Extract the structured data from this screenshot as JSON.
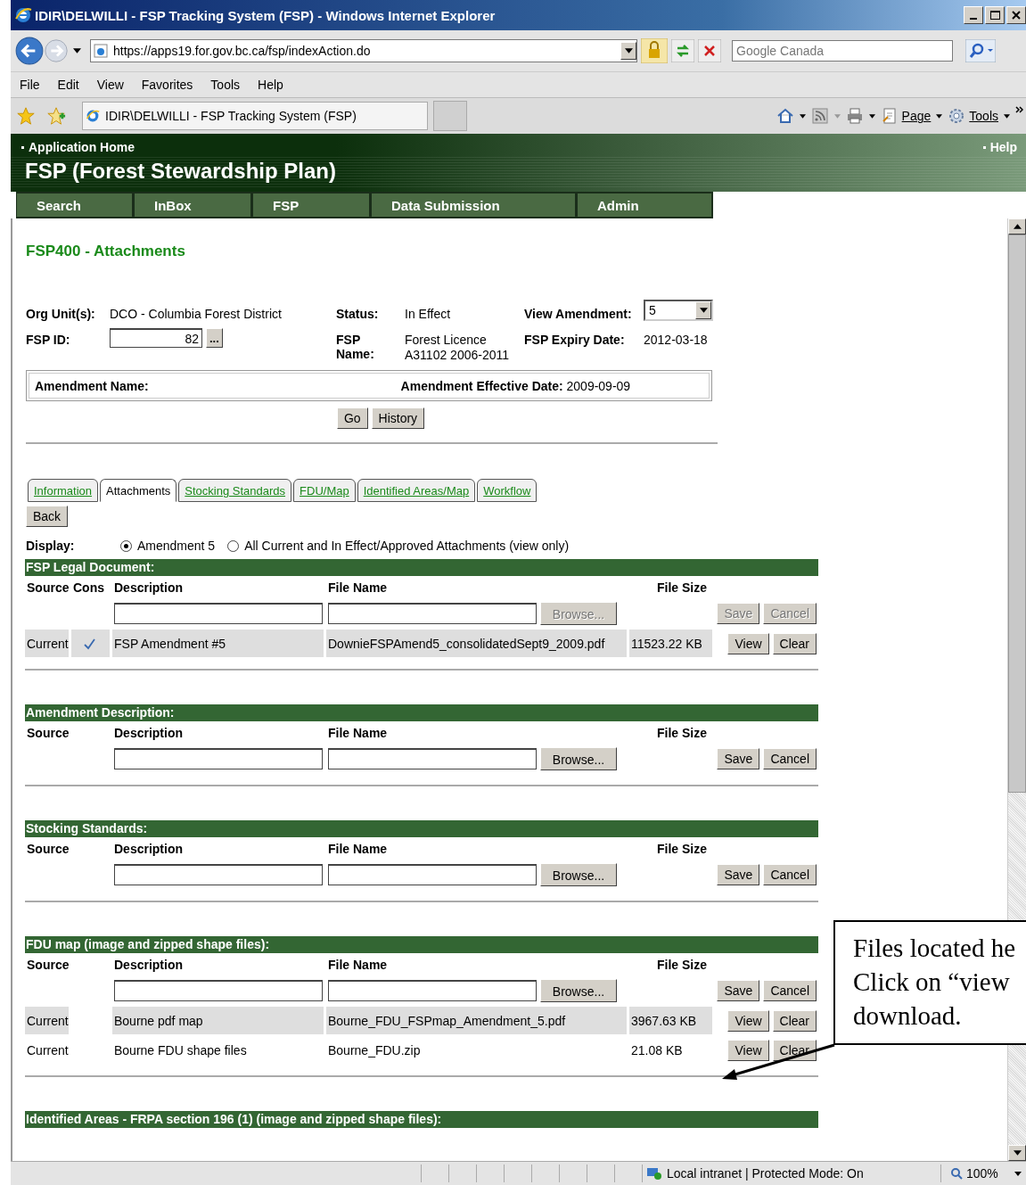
{
  "window": {
    "title": "IDIR\\DELWILLI - FSP Tracking System (FSP) - Windows Internet Explorer"
  },
  "address_bar": {
    "url": "https://apps19.for.gov.bc.ca/fsp/indexAction.do",
    "search_placeholder": "Google Canada"
  },
  "menu": [
    "File",
    "Edit",
    "View",
    "Favorites",
    "Tools",
    "Help"
  ],
  "browser_tab": {
    "title": "IDIR\\DELWILLI - FSP Tracking System (FSP)"
  },
  "command_bar": [
    {
      "label": "Page",
      "kind": "page"
    },
    {
      "label": "Tools",
      "kind": "tools"
    }
  ],
  "app_header": {
    "home_link": "Application Home",
    "help_link": "Help",
    "title": "FSP (Forest Stewardship Plan)"
  },
  "nav": [
    "Search",
    "InBox",
    "FSP",
    "Data Submission",
    "Admin"
  ],
  "page_title": "FSP400 - Attachments",
  "fields": [
    {
      "label": "Org Unit(s):",
      "value": "DCO - Columbia Forest District",
      "kind": "text"
    },
    {
      "label": "Status:",
      "value": "In Effect",
      "kind": "text"
    },
    {
      "label": "View Amendment:",
      "value": "5",
      "kind": "select"
    },
    {
      "label": "FSP ID:",
      "value": "82",
      "kind": "input",
      "button": "..."
    },
    {
      "label": "FSP Name:",
      "value": "Forest Licence A31102 2006-2011",
      "kind": "text"
    },
    {
      "label": "FSP Expiry Date:",
      "value": "2012-03-18",
      "kind": "text"
    }
  ],
  "amendment": {
    "name_label": "Amendment Name:",
    "date_label": "Amendment Effective Date:",
    "date": "2009-09-09"
  },
  "actions": [
    "Go",
    "History"
  ],
  "tabs": [
    {
      "label": "Information",
      "selected": false
    },
    {
      "label": "Attachments",
      "selected": true
    },
    {
      "label": "Stocking Standards",
      "selected": false
    },
    {
      "label": "FDU/Map",
      "selected": false
    },
    {
      "label": "Identified Areas/Map",
      "selected": false
    },
    {
      "label": "Workflow",
      "selected": false
    }
  ],
  "back_button": "Back",
  "display": {
    "label": "Display:",
    "options": [
      {
        "label": "Amendment 5",
        "selected": true
      },
      {
        "label": "All Current and In Effect/Approved Attachments (view only)",
        "selected": false
      }
    ]
  },
  "sections": [
    {
      "title": "FSP Legal Document:",
      "columns": [
        {
          "label": "Source",
          "kind": "source"
        },
        {
          "label": "Cons",
          "kind": "cons"
        },
        {
          "label": "Description",
          "kind": "description"
        },
        {
          "label": "File Name",
          "kind": "file"
        },
        {
          "label": "File Size",
          "kind": "size"
        }
      ],
      "upload": {
        "browse": "Browse...",
        "save": "Save",
        "cancel": "Cancel",
        "disabled": true
      },
      "rows": [
        {
          "source": "Current",
          "cons": true,
          "description": "FSP Amendment #5",
          "file_name": "DownieFSPAmend5_consolidatedSept9_2009.pdf",
          "file_size": "11523.22 KB",
          "view": "View",
          "clear": "Clear"
        }
      ]
    },
    {
      "title": "Amendment Description:",
      "columns": [
        {
          "label": "Source",
          "kind": "source"
        },
        {
          "label": "Description",
          "kind": "description"
        },
        {
          "label": "File Name",
          "kind": "file"
        },
        {
          "label": "File Size",
          "kind": "size"
        }
      ],
      "upload": {
        "browse": "Browse...",
        "save": "Save",
        "cancel": "Cancel",
        "disabled": false
      }
    },
    {
      "title": "Stocking Standards:",
      "columns": [
        {
          "label": "Source",
          "kind": "source"
        },
        {
          "label": "Description",
          "kind": "description"
        },
        {
          "label": "File Name",
          "kind": "file"
        },
        {
          "label": "File Size",
          "kind": "size"
        }
      ],
      "upload": {
        "browse": "Browse...",
        "save": "Save",
        "cancel": "Cancel",
        "disabled": false
      }
    },
    {
      "title": "FDU map (image and zipped shape files):",
      "columns": [
        {
          "label": "Source",
          "kind": "source"
        },
        {
          "label": "Description",
          "kind": "description"
        },
        {
          "label": "File Name",
          "kind": "file"
        },
        {
          "label": "File Size",
          "kind": "size"
        }
      ],
      "upload": {
        "browse": "Browse...",
        "save": "Save",
        "cancel": "Cancel",
        "disabled": false
      },
      "rows": [
        {
          "source": "Current",
          "description": "Bourne pdf map",
          "file_name": "Bourne_FDU_FSPmap_Amendment_5.pdf",
          "file_size": "3967.63 KB",
          "view": "View",
          "clear": "Clear"
        },
        {
          "source": "Current",
          "description": "Bourne FDU shape files",
          "file_name": "Bourne_FDU.zip",
          "file_size": "21.08 KB",
          "view": "View",
          "clear": "Clear"
        }
      ]
    },
    {
      "title": "Identified Areas - FRPA section 196 (1) (image and zipped shape files):"
    }
  ],
  "callout": {
    "lines": [
      "Files located he",
      "Click on “view",
      "download."
    ]
  },
  "status_bar": {
    "zone": "Local intranet | Protected Mode: On",
    "zoom": "100%"
  }
}
